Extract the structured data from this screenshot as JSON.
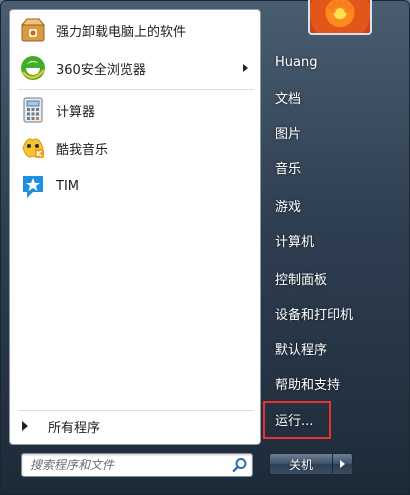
{
  "left_pane": {
    "pinned": [
      {
        "label": "强力卸载电脑上的软件",
        "icon": "uninstall-box-icon"
      },
      {
        "label": "360安全浏览器",
        "icon": "browser-360-icon",
        "has_submenu": true
      }
    ],
    "recent": [
      {
        "label": "计算器",
        "icon": "calculator-icon"
      },
      {
        "label": "酷我音乐",
        "icon": "kuwo-music-icon"
      },
      {
        "label": "TIM",
        "icon": "tim-icon"
      }
    ],
    "all_programs": "所有程序"
  },
  "search": {
    "placeholder": "搜索程序和文件",
    "icon": "search-icon"
  },
  "right_pane": {
    "items": [
      "Huang",
      "文档",
      "图片",
      "音乐",
      "游戏",
      "计算机",
      "控制面板",
      "设备和打印机",
      "默认程序",
      "帮助和支持",
      "运行..."
    ]
  },
  "shutdown": {
    "label": "关机"
  },
  "colors": {
    "highlight_border": "#e53333",
    "pane_background": "#ffffff",
    "menu_background": "#2f3f52"
  }
}
